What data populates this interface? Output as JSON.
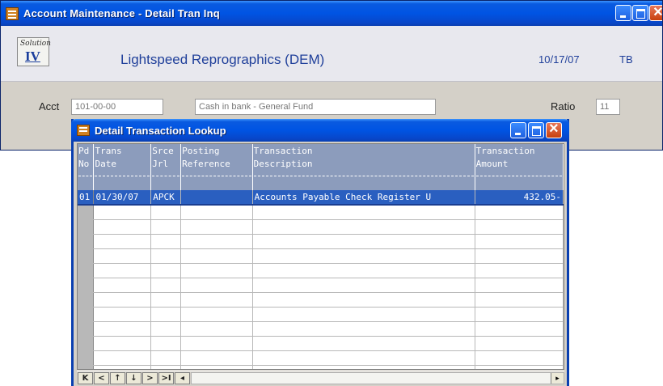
{
  "window": {
    "title": "Account Maintenance - Detail Tran Inq"
  },
  "header": {
    "logo_script": "Solution",
    "logo_text": "IV",
    "company": "Lightspeed Reprographics (DEM)",
    "date": "10/17/07",
    "user": "TB"
  },
  "form": {
    "acct_label": "Acct",
    "acct_value": "101-00-00",
    "acct_desc": "Cash in bank - General Fund",
    "ratio_label": "Ratio",
    "ratio_value": "11"
  },
  "dialog": {
    "title": "Detail Transaction Lookup",
    "columns": [
      {
        "line1": "Pd",
        "line2": "No"
      },
      {
        "line1": "Trans",
        "line2": "Date"
      },
      {
        "line1": "Srce",
        "line2": "Jrl"
      },
      {
        "line1": "Posting",
        "line2": "Reference"
      },
      {
        "line1": "Transaction",
        "line2": "Description"
      },
      {
        "line1": "Transaction",
        "line2": "Amount"
      }
    ],
    "rows": [
      {
        "pd": "01",
        "date": "01/30/07",
        "srce": "APCK",
        "ref": "",
        "desc": "Accounts Payable Check Register U",
        "amount": "432.05-"
      }
    ],
    "empty_rows": 12
  },
  "nav": {
    "first": "K",
    "prev": "<",
    "up": "↑",
    "down": "↓",
    "next": ">",
    "last": ">I",
    "scroll_left": "◂",
    "scroll_right": "▸"
  }
}
